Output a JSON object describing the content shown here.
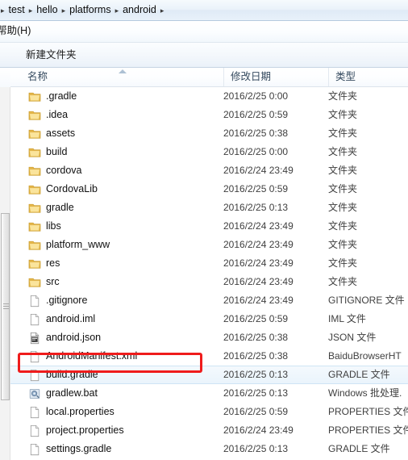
{
  "window": {
    "breadcrumb": {
      "separator": "▸",
      "leading_separator": "▸",
      "items": [
        "test",
        "hello",
        "platforms",
        "android"
      ],
      "trailing_separator": "▸"
    },
    "menubar": {
      "items": [
        "帮助(H)"
      ]
    },
    "toolbar": {
      "buttons": [
        "新建文件夹"
      ]
    }
  },
  "list": {
    "columns": [
      "名称",
      "修改日期",
      "类型"
    ],
    "sort": {
      "column": "名称",
      "direction": "ascending",
      "indicator": "sort-ascending-icon"
    },
    "rows": [
      {
        "name": ".gradle",
        "date": "2016/2/25 0:00",
        "type": "文件夹",
        "icon": "folder-icon",
        "selected": false
      },
      {
        "name": ".idea",
        "date": "2016/2/25 0:59",
        "type": "文件夹",
        "icon": "folder-icon",
        "selected": false
      },
      {
        "name": "assets",
        "date": "2016/2/25 0:38",
        "type": "文件夹",
        "icon": "folder-icon",
        "selected": false
      },
      {
        "name": "build",
        "date": "2016/2/25 0:00",
        "type": "文件夹",
        "icon": "folder-icon",
        "selected": false
      },
      {
        "name": "cordova",
        "date": "2016/2/24 23:49",
        "type": "文件夹",
        "icon": "folder-icon",
        "selected": false
      },
      {
        "name": "CordovaLib",
        "date": "2016/2/25 0:59",
        "type": "文件夹",
        "icon": "folder-icon",
        "selected": false
      },
      {
        "name": "gradle",
        "date": "2016/2/25 0:13",
        "type": "文件夹",
        "icon": "folder-icon",
        "selected": false
      },
      {
        "name": "libs",
        "date": "2016/2/24 23:49",
        "type": "文件夹",
        "icon": "folder-icon",
        "selected": false
      },
      {
        "name": "platform_www",
        "date": "2016/2/24 23:49",
        "type": "文件夹",
        "icon": "folder-icon",
        "selected": false
      },
      {
        "name": "res",
        "date": "2016/2/24 23:49",
        "type": "文件夹",
        "icon": "folder-icon",
        "selected": false
      },
      {
        "name": "src",
        "date": "2016/2/24 23:49",
        "type": "文件夹",
        "icon": "folder-icon",
        "selected": false
      },
      {
        "name": ".gitignore",
        "date": "2016/2/24 23:49",
        "type": "GITIGNORE 文件",
        "icon": "blank-file-icon",
        "selected": false
      },
      {
        "name": "android.iml",
        "date": "2016/2/25 0:59",
        "type": "IML 文件",
        "icon": "blank-file-icon",
        "selected": false
      },
      {
        "name": "android.json",
        "date": "2016/2/25 0:38",
        "type": "JSON 文件",
        "icon": "json-file-icon",
        "selected": false
      },
      {
        "name": "AndroidManifest.xml",
        "date": "2016/2/25 0:38",
        "type": "BaiduBrowserHT",
        "icon": "blank-file-icon",
        "selected": false
      },
      {
        "name": "build.gradle",
        "date": "2016/2/25 0:13",
        "type": "GRADLE 文件",
        "icon": "blank-file-icon",
        "selected": true
      },
      {
        "name": "gradlew.bat",
        "date": "2016/2/25 0:13",
        "type": "Windows 批处理.",
        "icon": "bat-file-icon",
        "selected": false
      },
      {
        "name": "local.properties",
        "date": "2016/2/25 0:59",
        "type": "PROPERTIES 文件",
        "icon": "blank-file-icon",
        "selected": false
      },
      {
        "name": "project.properties",
        "date": "2016/2/24 23:49",
        "type": "PROPERTIES 文件",
        "icon": "blank-file-icon",
        "selected": false
      },
      {
        "name": "settings.gradle",
        "date": "2016/2/25 0:13",
        "type": "GRADLE 文件",
        "icon": "blank-file-icon",
        "selected": false
      }
    ]
  },
  "annotation": {
    "target": "build.gradle",
    "color": "#ef1c1c",
    "shape": "rectangle"
  },
  "scrollbar": {
    "orientation": "vertical",
    "position": "left"
  }
}
